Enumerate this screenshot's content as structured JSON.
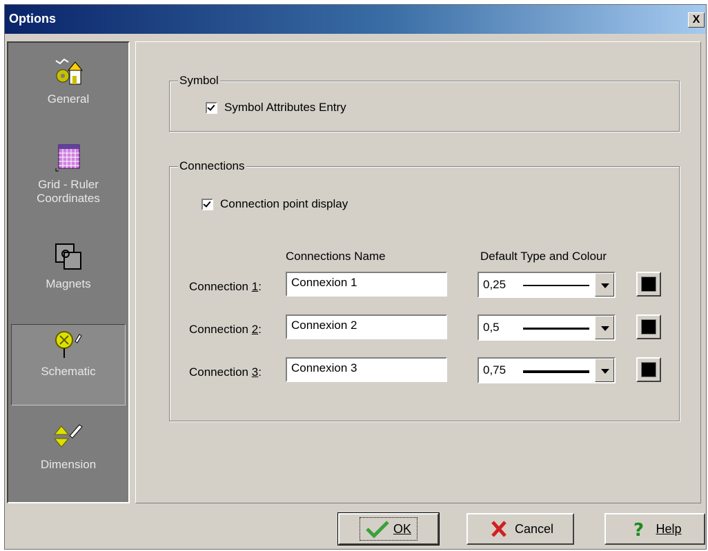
{
  "window": {
    "title": "Options",
    "close_label": "X"
  },
  "sidebar": {
    "items": [
      {
        "label": "General",
        "icon": "general-icon"
      },
      {
        "label": "Grid - Ruler Coordinates",
        "icon": "grid-icon"
      },
      {
        "label": "Magnets",
        "icon": "magnet-icon"
      },
      {
        "label": "Schematic",
        "icon": "schematic-icon",
        "selected": true
      },
      {
        "label": "Dimension",
        "icon": "dimension-icon"
      }
    ]
  },
  "symbol_group": {
    "legend": "Symbol",
    "checkbox_label": "Symbol Attributes Entry",
    "checked": true
  },
  "connections_group": {
    "legend": "Connections",
    "checkbox_label": "Connection point display",
    "checked": true,
    "col_name_header": "Connections Name",
    "col_type_header": "Default Type and Colour",
    "rows": [
      {
        "label": "Connection 1:",
        "name": "Connexion 1",
        "type": "0,25",
        "colour": "#000000"
      },
      {
        "label": "Connection 2:",
        "name": "Connexion 2",
        "type": "0,5",
        "colour": "#000000"
      },
      {
        "label": "Connection 3:",
        "name": "Connexion 3",
        "type": "0,75",
        "colour": "#000000"
      }
    ]
  },
  "buttons": {
    "ok": "OK",
    "cancel": "Cancel",
    "help": "Help"
  },
  "colors": {
    "title_start": "#0a246a",
    "title_end": "#a6caf0",
    "face": "#d4d0c8",
    "sidebar": "#7d7d7d"
  }
}
